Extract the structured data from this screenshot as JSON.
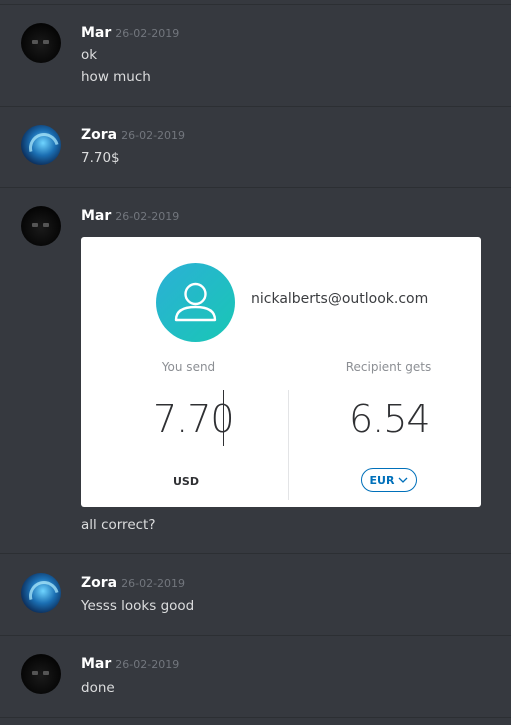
{
  "messages": [
    {
      "author": "Mar",
      "time": "26-02-2019",
      "lines": [
        "ok",
        "how much"
      ]
    },
    {
      "author": "Zora",
      "time": "26-02-2019",
      "lines": [
        "7.70$"
      ]
    },
    {
      "author": "Mar",
      "time": "26-02-2019",
      "lines": [
        "all correct?"
      ]
    },
    {
      "author": "Zora",
      "time": "26-02-2019",
      "lines": [
        "Yesss looks good"
      ]
    },
    {
      "author": "Mar",
      "time": "26-02-2019",
      "lines": [
        "done"
      ]
    }
  ],
  "card": {
    "email": "nickalberts@outlook.com",
    "you_send_label": "You send",
    "recipient_label": "Recipient gets",
    "send_amount": "7.70",
    "receive_amount": "6.54",
    "send_currency": "USD",
    "receive_currency": "EUR",
    "icons": {
      "avatar": "user-icon",
      "dropdown": "chevron-down-icon"
    },
    "colors": {
      "gradient_start": "#2bb0d6",
      "gradient_end": "#19c7b5",
      "accent": "#0070ba"
    }
  }
}
